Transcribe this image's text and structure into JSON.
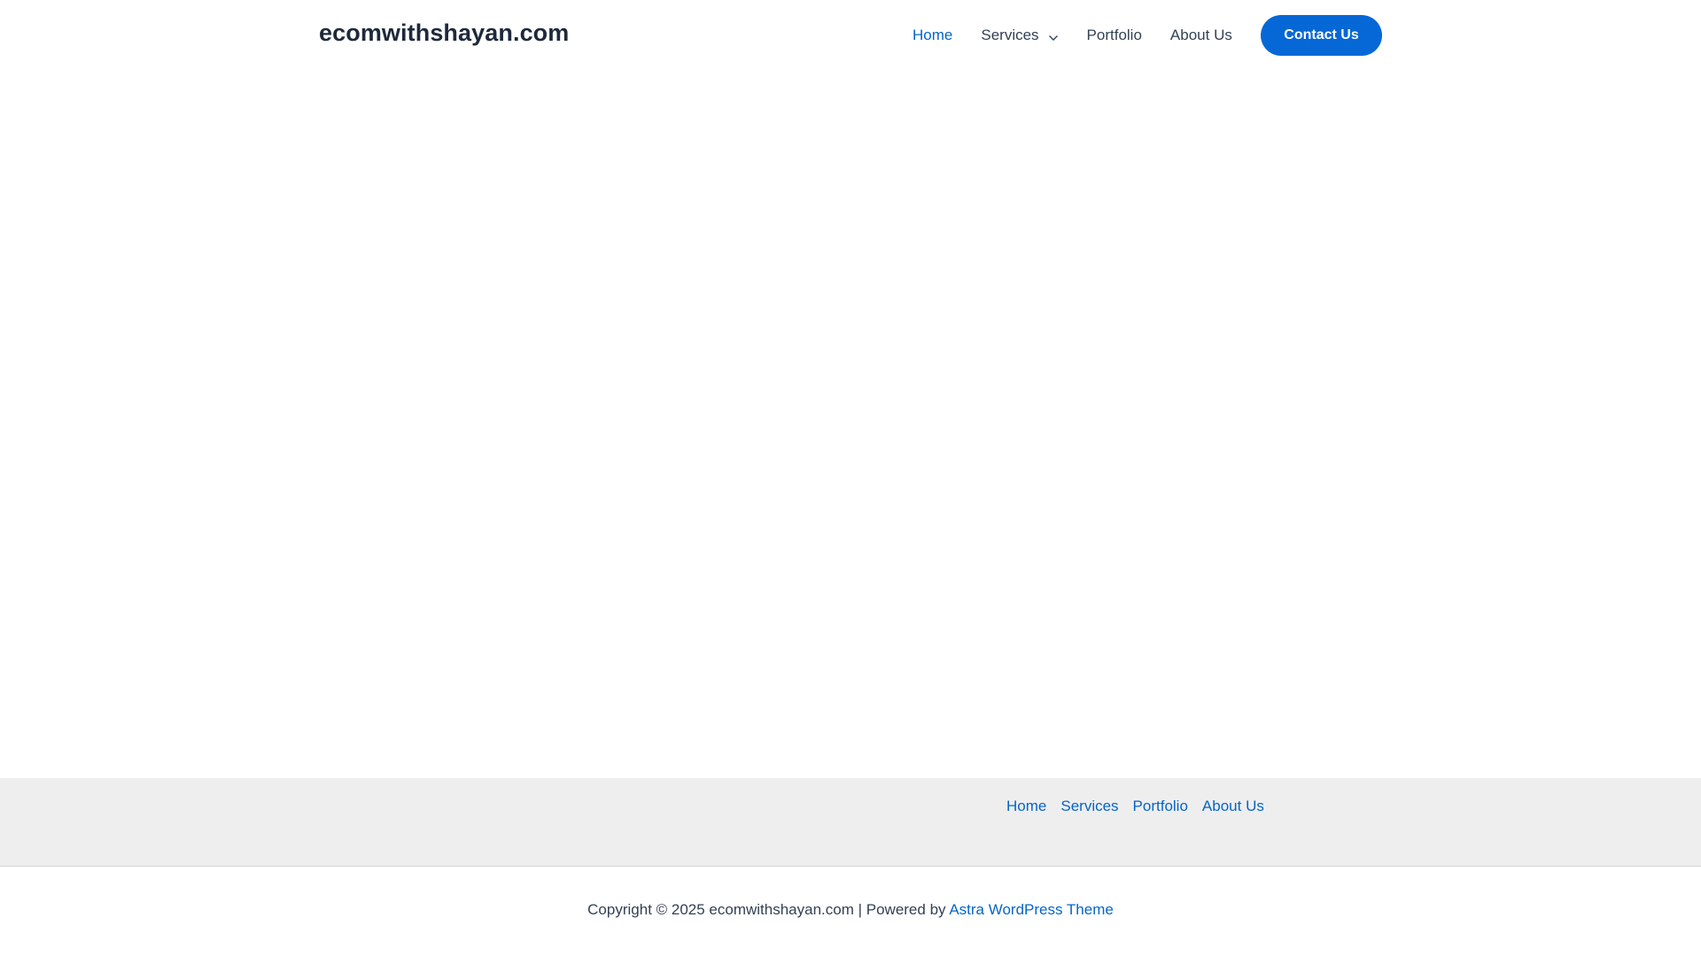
{
  "header": {
    "site_title": "ecomwithshayan.com",
    "nav": {
      "home": "Home",
      "services": "Services",
      "portfolio": "Portfolio",
      "about": "About Us"
    },
    "cta_label": "Contact Us"
  },
  "footer": {
    "menu": {
      "home": "Home",
      "services": "Services",
      "portfolio": "Portfolio",
      "about": "About Us"
    },
    "copyright_text": "Copyright © 2025 ecomwithshayan.com | Powered by",
    "theme_link": "Astra WordPress Theme"
  },
  "colors": {
    "accent": "#0667d6",
    "link": "#0565c8",
    "text": "#334155",
    "title": "#1e293b",
    "footer_bg": "#eeeeee"
  },
  "icons": {
    "services_dropdown": "chevron-down-icon"
  }
}
